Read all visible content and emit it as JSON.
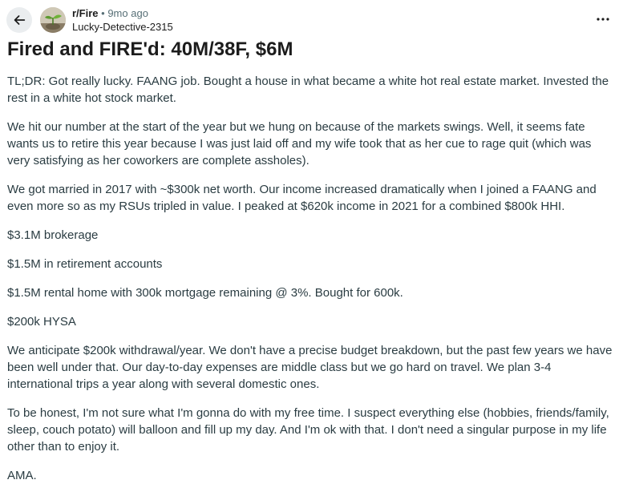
{
  "header": {
    "subreddit": "r/Fire",
    "separator": "•",
    "time_ago": "9mo ago",
    "author": "Lucky-Detective-2315",
    "more_label": "···"
  },
  "post": {
    "title": "Fired and FIRE'd: 40M/38F, $6M",
    "paragraphs": [
      "TL;DR: Got really lucky. FAANG job. Bought a house in what became a white hot real estate market. Invested the rest in a white hot stock market.",
      "We hit our number at the start of the year but we hung on because of the markets swings. Well, it seems fate wants us to retire this year because I was just laid off and my wife took that as her cue to rage quit (which was very satisfying as her coworkers are complete assholes).",
      "We got married in 2017 with ~$300k net worth. Our income increased dramatically when I joined a FAANG and even more so as my RSUs tripled in value. I peaked at $620k income in 2021 for a combined $800k HHI.",
      "$3.1M brokerage",
      "$1.5M in retirement accounts",
      "$1.5M rental home with 300k mortgage remaining @ 3%. Bought for 600k.",
      "$200k HYSA",
      "We anticipate $200k withdrawal/year. We don't have a precise budget breakdown, but the past few years we have been well under that. Our day-to-day expenses are middle class but we go hard on travel. We plan 3-4 international trips a year along with several domestic ones.",
      "To be honest, I'm not sure what I'm gonna do with my free time. I suspect everything else (hobbies, friends/family, sleep, couch potato) will balloon and fill up my day. And I'm ok with that. I don't need a singular purpose in my life other than to enjoy it.",
      "AMA."
    ]
  },
  "icons": {
    "back": "arrow-left-icon",
    "avatar": "subreddit-avatar-plant",
    "more": "more-horizontal-icon"
  },
  "colors": {
    "text_primary": "#1c1c1c",
    "text_body": "#2a3c42",
    "text_secondary": "#576f76",
    "back_button_bg": "#eaedef"
  }
}
